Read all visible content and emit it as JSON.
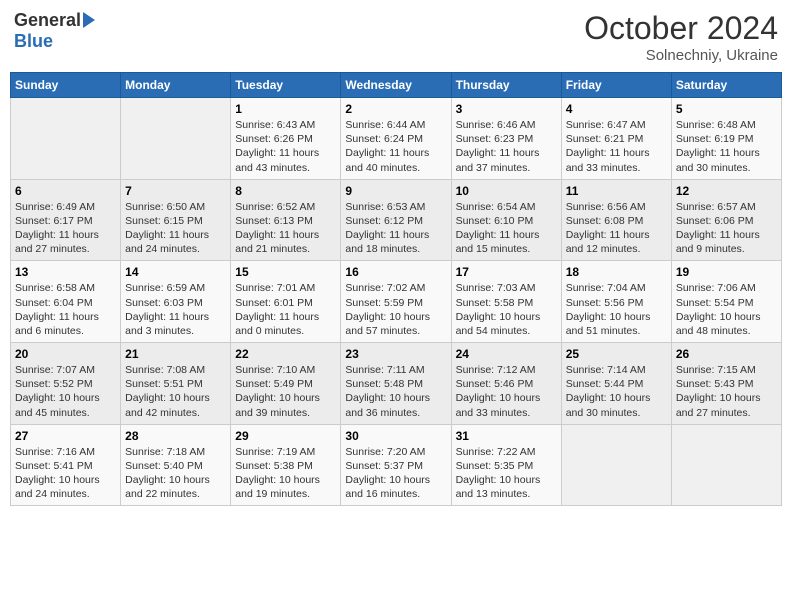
{
  "header": {
    "logo_general": "General",
    "logo_blue": "Blue",
    "month_title": "October 2024",
    "location": "Solnechniy, Ukraine"
  },
  "days_of_week": [
    "Sunday",
    "Monday",
    "Tuesday",
    "Wednesday",
    "Thursday",
    "Friday",
    "Saturday"
  ],
  "weeks": [
    [
      {
        "day": "",
        "info": ""
      },
      {
        "day": "",
        "info": ""
      },
      {
        "day": "1",
        "info": "Sunrise: 6:43 AM\nSunset: 6:26 PM\nDaylight: 11 hours and 43 minutes."
      },
      {
        "day": "2",
        "info": "Sunrise: 6:44 AM\nSunset: 6:24 PM\nDaylight: 11 hours and 40 minutes."
      },
      {
        "day": "3",
        "info": "Sunrise: 6:46 AM\nSunset: 6:23 PM\nDaylight: 11 hours and 37 minutes."
      },
      {
        "day": "4",
        "info": "Sunrise: 6:47 AM\nSunset: 6:21 PM\nDaylight: 11 hours and 33 minutes."
      },
      {
        "day": "5",
        "info": "Sunrise: 6:48 AM\nSunset: 6:19 PM\nDaylight: 11 hours and 30 minutes."
      }
    ],
    [
      {
        "day": "6",
        "info": "Sunrise: 6:49 AM\nSunset: 6:17 PM\nDaylight: 11 hours and 27 minutes."
      },
      {
        "day": "7",
        "info": "Sunrise: 6:50 AM\nSunset: 6:15 PM\nDaylight: 11 hours and 24 minutes."
      },
      {
        "day": "8",
        "info": "Sunrise: 6:52 AM\nSunset: 6:13 PM\nDaylight: 11 hours and 21 minutes."
      },
      {
        "day": "9",
        "info": "Sunrise: 6:53 AM\nSunset: 6:12 PM\nDaylight: 11 hours and 18 minutes."
      },
      {
        "day": "10",
        "info": "Sunrise: 6:54 AM\nSunset: 6:10 PM\nDaylight: 11 hours and 15 minutes."
      },
      {
        "day": "11",
        "info": "Sunrise: 6:56 AM\nSunset: 6:08 PM\nDaylight: 11 hours and 12 minutes."
      },
      {
        "day": "12",
        "info": "Sunrise: 6:57 AM\nSunset: 6:06 PM\nDaylight: 11 hours and 9 minutes."
      }
    ],
    [
      {
        "day": "13",
        "info": "Sunrise: 6:58 AM\nSunset: 6:04 PM\nDaylight: 11 hours and 6 minutes."
      },
      {
        "day": "14",
        "info": "Sunrise: 6:59 AM\nSunset: 6:03 PM\nDaylight: 11 hours and 3 minutes."
      },
      {
        "day": "15",
        "info": "Sunrise: 7:01 AM\nSunset: 6:01 PM\nDaylight: 11 hours and 0 minutes."
      },
      {
        "day": "16",
        "info": "Sunrise: 7:02 AM\nSunset: 5:59 PM\nDaylight: 10 hours and 57 minutes."
      },
      {
        "day": "17",
        "info": "Sunrise: 7:03 AM\nSunset: 5:58 PM\nDaylight: 10 hours and 54 minutes."
      },
      {
        "day": "18",
        "info": "Sunrise: 7:04 AM\nSunset: 5:56 PM\nDaylight: 10 hours and 51 minutes."
      },
      {
        "day": "19",
        "info": "Sunrise: 7:06 AM\nSunset: 5:54 PM\nDaylight: 10 hours and 48 minutes."
      }
    ],
    [
      {
        "day": "20",
        "info": "Sunrise: 7:07 AM\nSunset: 5:52 PM\nDaylight: 10 hours and 45 minutes."
      },
      {
        "day": "21",
        "info": "Sunrise: 7:08 AM\nSunset: 5:51 PM\nDaylight: 10 hours and 42 minutes."
      },
      {
        "day": "22",
        "info": "Sunrise: 7:10 AM\nSunset: 5:49 PM\nDaylight: 10 hours and 39 minutes."
      },
      {
        "day": "23",
        "info": "Sunrise: 7:11 AM\nSunset: 5:48 PM\nDaylight: 10 hours and 36 minutes."
      },
      {
        "day": "24",
        "info": "Sunrise: 7:12 AM\nSunset: 5:46 PM\nDaylight: 10 hours and 33 minutes."
      },
      {
        "day": "25",
        "info": "Sunrise: 7:14 AM\nSunset: 5:44 PM\nDaylight: 10 hours and 30 minutes."
      },
      {
        "day": "26",
        "info": "Sunrise: 7:15 AM\nSunset: 5:43 PM\nDaylight: 10 hours and 27 minutes."
      }
    ],
    [
      {
        "day": "27",
        "info": "Sunrise: 7:16 AM\nSunset: 5:41 PM\nDaylight: 10 hours and 24 minutes."
      },
      {
        "day": "28",
        "info": "Sunrise: 7:18 AM\nSunset: 5:40 PM\nDaylight: 10 hours and 22 minutes."
      },
      {
        "day": "29",
        "info": "Sunrise: 7:19 AM\nSunset: 5:38 PM\nDaylight: 10 hours and 19 minutes."
      },
      {
        "day": "30",
        "info": "Sunrise: 7:20 AM\nSunset: 5:37 PM\nDaylight: 10 hours and 16 minutes."
      },
      {
        "day": "31",
        "info": "Sunrise: 7:22 AM\nSunset: 5:35 PM\nDaylight: 10 hours and 13 minutes."
      },
      {
        "day": "",
        "info": ""
      },
      {
        "day": "",
        "info": ""
      }
    ]
  ]
}
